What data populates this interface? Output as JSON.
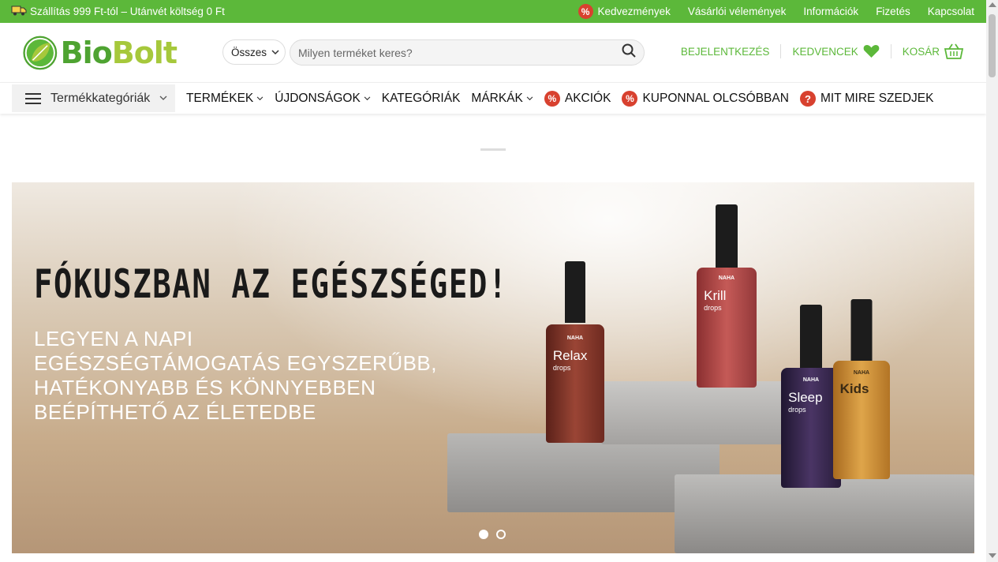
{
  "topbar": {
    "shipping_text": "Szállítás 999 Ft-tól – Utánvét költség 0 Ft",
    "links": {
      "discounts": "Kedvezmények",
      "reviews": "Vásárlói vélemények",
      "info": "Információk",
      "payment": "Fizetés",
      "contact": "Kapcsolat"
    }
  },
  "header": {
    "logo_part1": "Bio",
    "logo_part2": "Bolt",
    "scope_label": "Összes",
    "search_placeholder": "Milyen terméket keres?",
    "login": "BEJELENTKEZÉS",
    "favorites": "KEDVENCEK",
    "cart": "KOSÁR"
  },
  "nav": {
    "categories_button": "Termékkategóriák",
    "items": {
      "products": "TERMÉKEK",
      "new": "ÚJDONSÁGOK",
      "categories": "KATEGÓRIÁK",
      "brands": "MÁRKÁK",
      "sales": "AKCIÓK",
      "coupons": "KUPONNAL OLCSÓBBAN",
      "guide": "MIT MIRE SZEDJEK"
    }
  },
  "banner": {
    "headline": "FÓKUSZBAN AZ EGÉSZSÉGED!",
    "sub_lines": [
      "LEGYEN A NAPI",
      "EGÉSZSÉGTÁMOGATÁS EGYSZERŰBB,",
      "HATÉKONYABB ÉS KÖNNYEBBEN",
      "BEÉPÍTHETŐ AZ ÉLETEDBE"
    ],
    "bottles": {
      "relax": {
        "brand": "NAHA",
        "name": "Relax",
        "sub": "drops",
        "color": "#8a3a2f"
      },
      "krill": {
        "brand": "NAHA",
        "name": "Krill",
        "sub": "drops",
        "color": "#b24a48"
      },
      "sleep": {
        "brand": "NAHA",
        "name": "Sleep",
        "sub": "drops",
        "color": "#3b2a4a"
      },
      "kids": {
        "brand": "NAHA",
        "name": "Kids",
        "sub": "",
        "color": "#c9892f"
      }
    },
    "slides_total": 2,
    "active_slide": 1
  },
  "colors": {
    "brand_green": "#5cb83a",
    "accent_red": "#d8412f"
  }
}
